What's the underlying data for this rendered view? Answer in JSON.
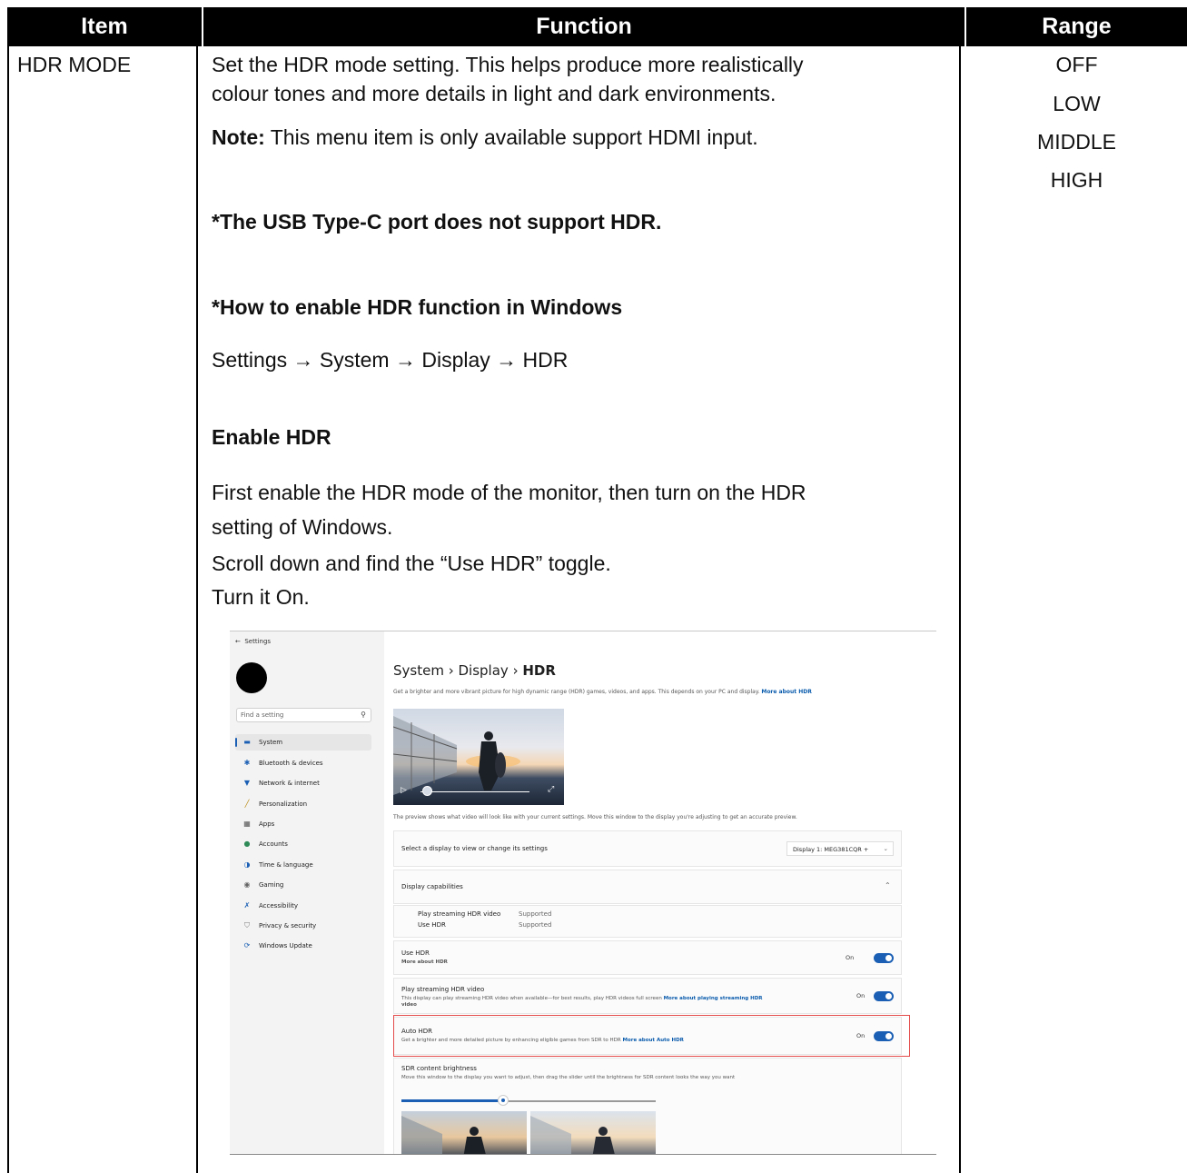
{
  "table": {
    "headers": {
      "item": "Item",
      "function": "Function",
      "range": "Range"
    },
    "row": {
      "item": "HDR MODE",
      "function_lines": [
        "Set the HDR mode setting. This helps produce more realistically",
        "colour tones and more details in light and dark environments."
      ],
      "note_label": "Note:",
      "note_text": " This menu item is only available support HDMI input.",
      "usbc_note": "*The USB Type-C port does not support HDR.",
      "howto_heading": "*How to enable HDR function in Windows",
      "path": "Settings → System → Display → HDR",
      "enable_heading": "Enable HDR",
      "enable_lines": [
        "First enable the HDR mode of the monitor, then turn on the HDR",
        "setting of Windows.",
        "Scroll down and find the “Use HDR” toggle.",
        "Turn it On."
      ],
      "range": [
        "OFF",
        "LOW",
        "MIDDLE",
        "HIGH"
      ]
    }
  },
  "screenshot": {
    "window_title": "Settings",
    "search_placeholder": "Find a setting",
    "nav": [
      {
        "label": "System",
        "icon": "monitor-icon",
        "selected": true
      },
      {
        "label": "Bluetooth & devices",
        "icon": "bluetooth-icon"
      },
      {
        "label": "Network & internet",
        "icon": "wifi-icon"
      },
      {
        "label": "Personalization",
        "icon": "brush-icon"
      },
      {
        "label": "Apps",
        "icon": "apps-icon"
      },
      {
        "label": "Accounts",
        "icon": "person-icon"
      },
      {
        "label": "Time & language",
        "icon": "globe-icon"
      },
      {
        "label": "Gaming",
        "icon": "gamepad-icon"
      },
      {
        "label": "Accessibility",
        "icon": "accessibility-icon"
      },
      {
        "label": "Privacy & security",
        "icon": "shield-icon"
      },
      {
        "label": "Windows Update",
        "icon": "update-icon"
      }
    ],
    "breadcrumb": {
      "a": "System",
      "sep": "›",
      "b": "Display",
      "c": "HDR"
    },
    "description": "Get a brighter and more vibrant picture for high dynamic range (HDR) games, videos, and apps. This depends on your PC and display.",
    "description_link": "More about HDR",
    "preview_caption": "The preview shows what video will look like with your current settings. Move this window to the display you're adjusting to get an accurate preview.",
    "select_display_label": "Select a display to view or change its settings",
    "display_value": "Display 1: MEG381CQR +",
    "capabilities_label": "Display capabilities",
    "capabilities": [
      {
        "name": "Play streaming HDR video",
        "value": "Supported"
      },
      {
        "name": "Use HDR",
        "value": "Supported"
      }
    ],
    "use_hdr": {
      "title": "Use HDR",
      "link": "More about HDR",
      "state": "On"
    },
    "streaming": {
      "title": "Play streaming HDR video",
      "text": "This display can play streaming HDR video when available—for best results, play HDR videos full screen",
      "link": "More about playing streaming HDR",
      "link2": "video",
      "state": "On"
    },
    "auto_hdr": {
      "title": "Auto HDR",
      "text": "Get a brighter and more detailed picture by enhancing eligible games from SDR to HDR",
      "link": "More about Auto HDR",
      "state": "On"
    },
    "sdr": {
      "title": "SDR content brightness",
      "text": "Move this window to the display you want to adjust, then drag the slider until the brightness for SDR content looks the way you want",
      "level": 0.4
    },
    "accent_color": "#1a5fb4",
    "highlight_color": "#e34a4a"
  }
}
